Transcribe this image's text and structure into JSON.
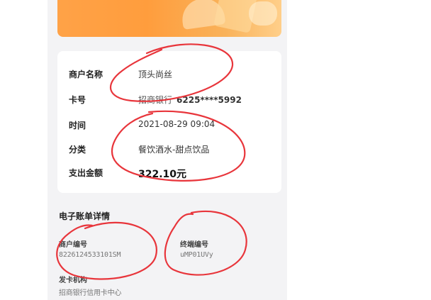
{
  "merchant": {
    "label": "商户名称",
    "value": "顶头尚丝"
  },
  "card": {
    "label": "卡号",
    "bank": "招商银行",
    "number": "6225****5992"
  },
  "time": {
    "label": "时间",
    "value": "2021-08-29 09:04"
  },
  "category": {
    "label": "分类",
    "value": "餐饮酒水-甜点饮品"
  },
  "amount": {
    "label": "支出金额",
    "value": "322.10元"
  },
  "ebill": {
    "title": "电子账单详情",
    "merchant_no_label": "商户编号",
    "merchant_no_value": "8226124533101SM",
    "terminal_no_label": "终端编号",
    "terminal_no_value": "uMP01UVy",
    "issuer_label": "发卡机构",
    "issuer_value": "招商银行信用卡中心"
  },
  "colors": {
    "annotation": "#e8353b",
    "banner": "#ffa247"
  }
}
